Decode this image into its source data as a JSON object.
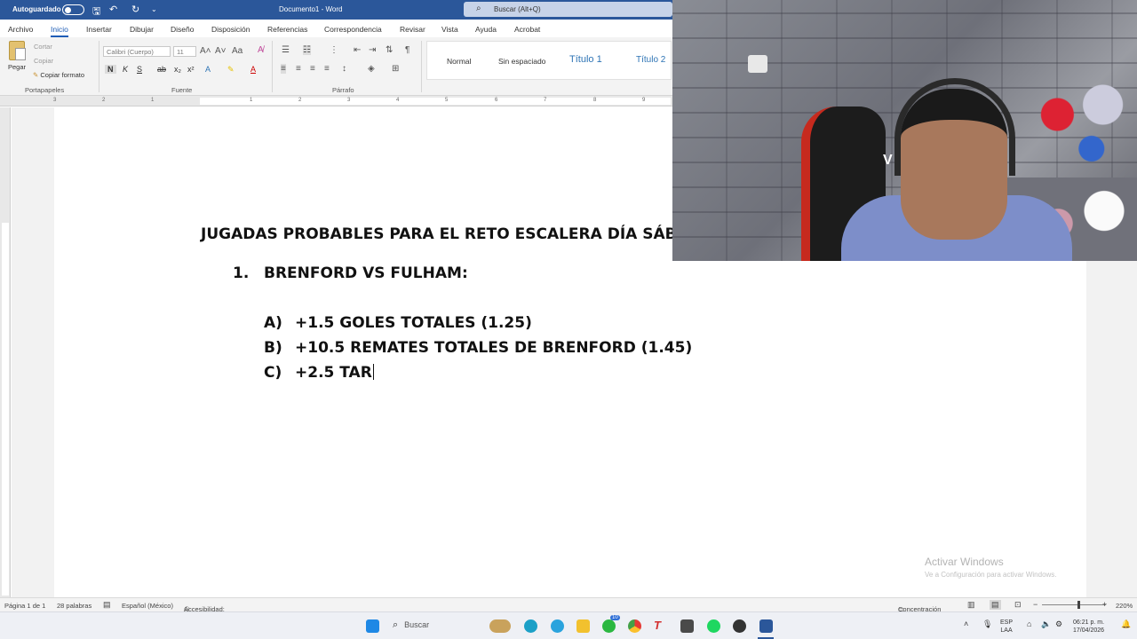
{
  "titlebar": {
    "autosave_label": "Autoguardado",
    "doc_title": "Documento1 - Word",
    "search_placeholder": "Buscar (Alt+Q)"
  },
  "tabs": [
    "Archivo",
    "Inicio",
    "Insertar",
    "Dibujar",
    "Diseño",
    "Disposición",
    "Referencias",
    "Correspondencia",
    "Revisar",
    "Vista",
    "Ayuda",
    "Acrobat"
  ],
  "active_tab": "Inicio",
  "ribbon": {
    "clipboard": {
      "paste": "Pegar",
      "cut": "Cortar",
      "copy": "Copiar",
      "format_painter": "Copiar formato",
      "group_label": "Portapapeles"
    },
    "font": {
      "font_name": "Calibri (Cuerpo)",
      "font_size": "11",
      "group_label": "Fuente"
    },
    "paragraph": {
      "group_label": "Párrafo"
    },
    "styles": [
      "Normal",
      "Sin espaciado",
      "Título 1",
      "Título 2"
    ]
  },
  "ruler_numbers": [
    "3",
    "2",
    "1",
    "1",
    "2",
    "3",
    "4",
    "5",
    "6",
    "7",
    "8",
    "9"
  ],
  "document": {
    "title": "JUGADAS PROBABLES PARA EL RETO ESCALERA DÍA SÁBADO",
    "item_number": "1.",
    "item_text": "BRENFORD VS FULHAM:",
    "subitems": [
      {
        "marker": "A)",
        "text": "+1.5 GOLES TOTALES (1.25)"
      },
      {
        "marker": "B)",
        "text": "+10.5 REMATES TOTALES DE BRENFORD (1.45)"
      },
      {
        "marker": "C)",
        "text": "+2.5 TAR"
      }
    ]
  },
  "watermark": {
    "line1": "Activar Windows",
    "line2": "Ve a Configuración para activar Windows."
  },
  "statusbar": {
    "page": "Página 1 de 1",
    "words": "28 palabras",
    "language": "Español (México)",
    "accessibility": "Accesibilidad: todo correcto",
    "focus": "Concentración",
    "zoom": "220%"
  },
  "taskbar": {
    "search": "Buscar",
    "badge": "10",
    "lang_line1": "ESP",
    "lang_line2": "LAA",
    "time": "06:21 p. m.",
    "date": "17/04/2026"
  },
  "webcam": {
    "chair_text": "V"
  },
  "colors": {
    "word_blue": "#2b579a",
    "accent": "#1e5db6"
  }
}
